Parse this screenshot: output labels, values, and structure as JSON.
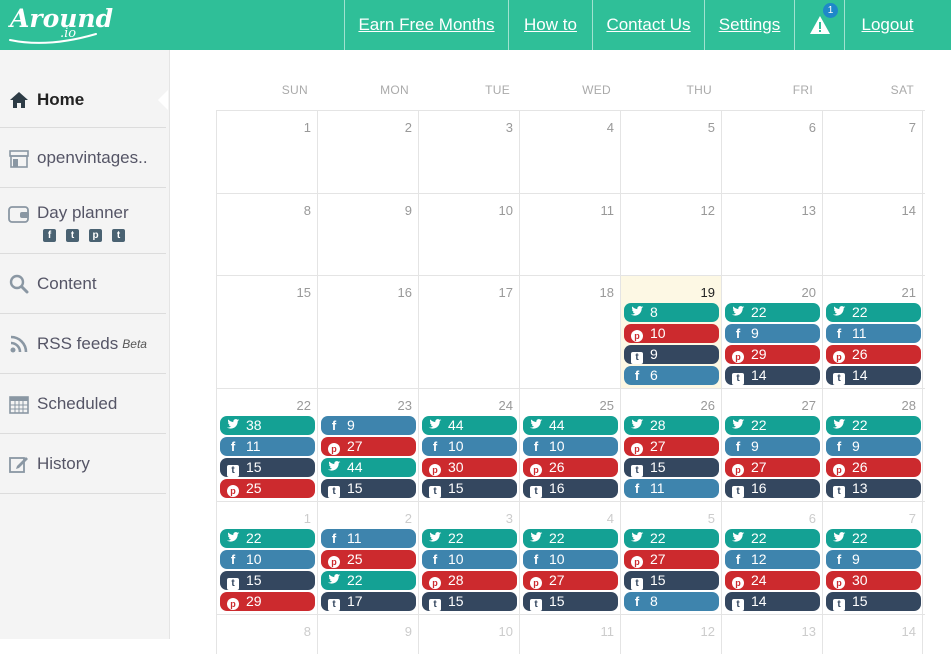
{
  "brand": {
    "logo_text": "Around",
    "logo_suffix": ".io",
    "accent": "#2fbf98"
  },
  "nav": {
    "items": [
      {
        "label": "Earn Free Months",
        "name": "nav-earn-free-months"
      },
      {
        "label": "How to",
        "name": "nav-how-to"
      },
      {
        "label": "Contact Us",
        "name": "nav-contact-us"
      },
      {
        "label": "Settings",
        "name": "nav-settings"
      },
      {
        "label": "",
        "name": "nav-alerts",
        "icon": "warning-icon",
        "badge": "1"
      },
      {
        "label": "Logout",
        "name": "nav-logout"
      }
    ]
  },
  "sidebar": {
    "items": [
      {
        "label": "Home",
        "icon": "home-icon",
        "active": true
      },
      {
        "label": "openvintages..",
        "icon": "store-icon"
      },
      {
        "label": "Day planner",
        "icon": "wallet-icon",
        "sub_icons": [
          "facebook-icon",
          "twitter-icon",
          "pinterest-icon",
          "tumblr-icon"
        ]
      },
      {
        "label": "Content",
        "icon": "search-icon"
      },
      {
        "label": "RSS feeds",
        "icon": "rss-icon",
        "sup": "Beta"
      },
      {
        "label": "Scheduled",
        "icon": "calendar-icon"
      },
      {
        "label": "History",
        "icon": "edit-icon"
      }
    ]
  },
  "calendar": {
    "days_of_week": [
      "SUN",
      "MON",
      "TUE",
      "WED",
      "THU",
      "FRI",
      "SAT"
    ],
    "today": "19",
    "weeks": [
      {
        "days": [
          {
            "num": "1",
            "posts": []
          },
          {
            "num": "2",
            "posts": []
          },
          {
            "num": "3",
            "posts": []
          },
          {
            "num": "4",
            "posts": []
          },
          {
            "num": "5",
            "posts": []
          },
          {
            "num": "6",
            "posts": []
          },
          {
            "num": "7",
            "posts": []
          }
        ]
      },
      {
        "days": [
          {
            "num": "8",
            "posts": []
          },
          {
            "num": "9",
            "posts": []
          },
          {
            "num": "10",
            "posts": []
          },
          {
            "num": "11",
            "posts": []
          },
          {
            "num": "12",
            "posts": []
          },
          {
            "num": "13",
            "posts": []
          },
          {
            "num": "14",
            "posts": []
          }
        ]
      },
      {
        "days": [
          {
            "num": "15",
            "posts": []
          },
          {
            "num": "16",
            "posts": []
          },
          {
            "num": "17",
            "posts": []
          },
          {
            "num": "18",
            "posts": []
          },
          {
            "num": "19",
            "today": true,
            "posts": [
              {
                "network": "twitter",
                "count": "8"
              },
              {
                "network": "pinterest",
                "count": "10"
              },
              {
                "network": "tumblr",
                "count": "9"
              },
              {
                "network": "facebook",
                "count": "6"
              }
            ]
          },
          {
            "num": "20",
            "posts": [
              {
                "network": "twitter",
                "count": "22"
              },
              {
                "network": "facebook",
                "count": "9"
              },
              {
                "network": "pinterest",
                "count": "29"
              },
              {
                "network": "tumblr",
                "count": "14"
              }
            ]
          },
          {
            "num": "21",
            "posts": [
              {
                "network": "twitter",
                "count": "22"
              },
              {
                "network": "facebook",
                "count": "11"
              },
              {
                "network": "pinterest",
                "count": "26"
              },
              {
                "network": "tumblr",
                "count": "14"
              }
            ]
          }
        ]
      },
      {
        "days": [
          {
            "num": "22",
            "posts": [
              {
                "network": "twitter",
                "count": "38"
              },
              {
                "network": "facebook",
                "count": "11"
              },
              {
                "network": "tumblr",
                "count": "15"
              },
              {
                "network": "pinterest",
                "count": "25"
              }
            ]
          },
          {
            "num": "23",
            "posts": [
              {
                "network": "facebook",
                "count": "9"
              },
              {
                "network": "pinterest",
                "count": "27"
              },
              {
                "network": "twitter",
                "count": "44"
              },
              {
                "network": "tumblr",
                "count": "15"
              }
            ]
          },
          {
            "num": "24",
            "posts": [
              {
                "network": "twitter",
                "count": "44"
              },
              {
                "network": "facebook",
                "count": "10"
              },
              {
                "network": "pinterest",
                "count": "30"
              },
              {
                "network": "tumblr",
                "count": "15"
              }
            ]
          },
          {
            "num": "25",
            "posts": [
              {
                "network": "twitter",
                "count": "44"
              },
              {
                "network": "facebook",
                "count": "10"
              },
              {
                "network": "pinterest",
                "count": "26"
              },
              {
                "network": "tumblr",
                "count": "16"
              }
            ]
          },
          {
            "num": "26",
            "posts": [
              {
                "network": "twitter",
                "count": "28"
              },
              {
                "network": "pinterest",
                "count": "27"
              },
              {
                "network": "tumblr",
                "count": "15"
              },
              {
                "network": "facebook",
                "count": "11"
              }
            ]
          },
          {
            "num": "27",
            "posts": [
              {
                "network": "twitter",
                "count": "22"
              },
              {
                "network": "facebook",
                "count": "9"
              },
              {
                "network": "pinterest",
                "count": "27"
              },
              {
                "network": "tumblr",
                "count": "16"
              }
            ]
          },
          {
            "num": "28",
            "posts": [
              {
                "network": "twitter",
                "count": "22"
              },
              {
                "network": "facebook",
                "count": "9"
              },
              {
                "network": "pinterest",
                "count": "26"
              },
              {
                "network": "tumblr",
                "count": "13"
              }
            ]
          }
        ]
      },
      {
        "days": [
          {
            "num": "1",
            "next_month": true,
            "posts": [
              {
                "network": "twitter",
                "count": "22"
              },
              {
                "network": "facebook",
                "count": "10"
              },
              {
                "network": "tumblr",
                "count": "15"
              },
              {
                "network": "pinterest",
                "count": "29"
              }
            ]
          },
          {
            "num": "2",
            "next_month": true,
            "posts": [
              {
                "network": "facebook",
                "count": "11"
              },
              {
                "network": "pinterest",
                "count": "25"
              },
              {
                "network": "twitter",
                "count": "22"
              },
              {
                "network": "tumblr",
                "count": "17"
              }
            ]
          },
          {
            "num": "3",
            "next_month": true,
            "posts": [
              {
                "network": "twitter",
                "count": "22"
              },
              {
                "network": "facebook",
                "count": "10"
              },
              {
                "network": "pinterest",
                "count": "28"
              },
              {
                "network": "tumblr",
                "count": "15"
              }
            ]
          },
          {
            "num": "4",
            "next_month": true,
            "posts": [
              {
                "network": "twitter",
                "count": "22"
              },
              {
                "network": "facebook",
                "count": "10"
              },
              {
                "network": "pinterest",
                "count": "27"
              },
              {
                "network": "tumblr",
                "count": "15"
              }
            ]
          },
          {
            "num": "5",
            "next_month": true,
            "posts": [
              {
                "network": "twitter",
                "count": "22"
              },
              {
                "network": "pinterest",
                "count": "27"
              },
              {
                "network": "tumblr",
                "count": "15"
              },
              {
                "network": "facebook",
                "count": "8"
              }
            ]
          },
          {
            "num": "6",
            "next_month": true,
            "posts": [
              {
                "network": "twitter",
                "count": "22"
              },
              {
                "network": "facebook",
                "count": "12"
              },
              {
                "network": "pinterest",
                "count": "24"
              },
              {
                "network": "tumblr",
                "count": "14"
              }
            ]
          },
          {
            "num": "7",
            "next_month": true,
            "posts": [
              {
                "network": "twitter",
                "count": "22"
              },
              {
                "network": "facebook",
                "count": "9"
              },
              {
                "network": "pinterest",
                "count": "30"
              },
              {
                "network": "tumblr",
                "count": "15"
              }
            ]
          }
        ]
      },
      {
        "days": [
          {
            "num": "8",
            "next_month": true,
            "posts": []
          },
          {
            "num": "9",
            "next_month": true,
            "posts": []
          },
          {
            "num": "10",
            "next_month": true,
            "posts": []
          },
          {
            "num": "11",
            "next_month": true,
            "posts": []
          },
          {
            "num": "12",
            "next_month": true,
            "posts": []
          },
          {
            "num": "13",
            "next_month": true,
            "posts": []
          },
          {
            "num": "14",
            "next_month": true,
            "posts": []
          }
        ]
      }
    ]
  }
}
